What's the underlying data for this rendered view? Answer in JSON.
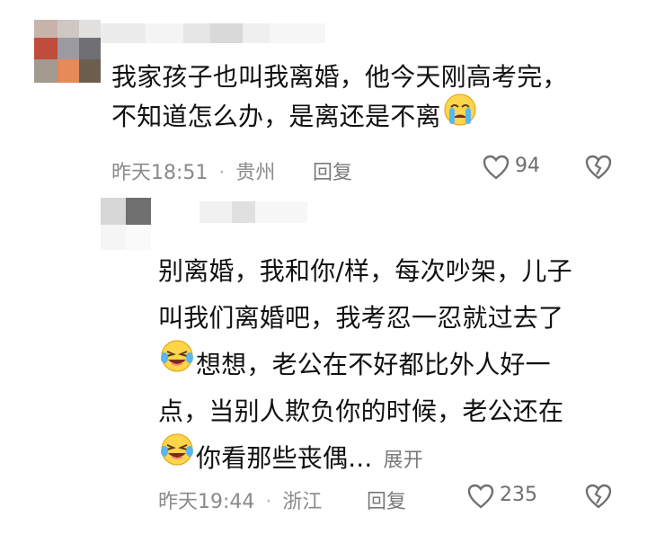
{
  "comments": [
    {
      "text_line1": "我家孩子也叫我离婚，他今天刚高考完，",
      "text_line2_before_emoji": "不知道怎么办，是离还是不离",
      "emoji": "crying-face",
      "time": "昨天18:51",
      "sep": "·",
      "location": "贵州",
      "reply_label": "回复",
      "likes": "94"
    },
    {
      "line1": "别离婚，我和你/样，每次吵架，儿子",
      "line2": "叫我们离婚吧，我考忍一忍就过去了",
      "line3_after_emoji": "想想，老公在不好都比外人好一",
      "line4": "点，当别人欺负你的时候，老公还在",
      "line5_after_emoji": "你看那些丧偶...",
      "expand_label": "展开",
      "emoji": "laughing-crying-face",
      "time": "昨天19:44",
      "sep": "·",
      "location": "浙江",
      "reply_label": "回复",
      "likes": "235"
    }
  ],
  "colors": {
    "text": "#111111",
    "meta": "#8a8a8a"
  }
}
